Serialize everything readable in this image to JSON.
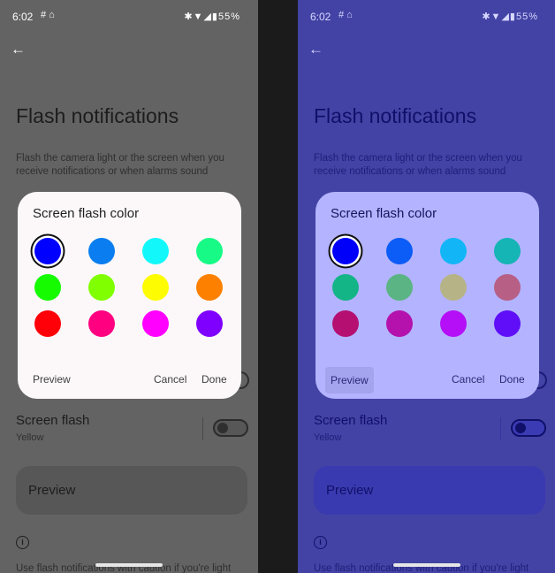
{
  "status_bar": {
    "time": "6:02",
    "notification_icons": [
      "grid-icon",
      "home-icon"
    ],
    "system_icons": [
      "bluetooth-icon",
      "wifi-icon",
      "signal-icon"
    ],
    "battery": "55%"
  },
  "page": {
    "title": "Flash notifications",
    "description": "Flash the camera light or the screen when you receive notifications or when alarms sound",
    "screen_flash": {
      "title": "Screen flash",
      "subtitle": "Yellow"
    },
    "preview_label": "Preview",
    "caution": "Use flash notifications with caution if you're light"
  },
  "dialog": {
    "title": "Screen flash color",
    "buttons": {
      "preview": "Preview",
      "cancel": "Cancel",
      "done": "Done"
    }
  },
  "left_swatches": [
    "#0000fe",
    "#0a7ef0",
    "#12f8fa",
    "#17fa86",
    "#16fb00",
    "#80ff00",
    "#fdfc00",
    "#fe8000",
    "#ff0008",
    "#ff0180",
    "#ff00ff",
    "#8000ff"
  ],
  "right_swatches": [
    "#0000fa",
    "#0c5cf7",
    "#12b6f6",
    "#15b4b5",
    "#13b486",
    "#5bb483",
    "#b6b486",
    "#b75f85",
    "#b50f72",
    "#b411ad",
    "#b40ff6",
    "#5f0ef7"
  ],
  "selected_swatch_index": 0,
  "colors": {
    "left_background": "#636363",
    "right_background": "#4343a5",
    "left_dialog": "#fcf8f9",
    "right_dialog": "#b3b3ff"
  }
}
